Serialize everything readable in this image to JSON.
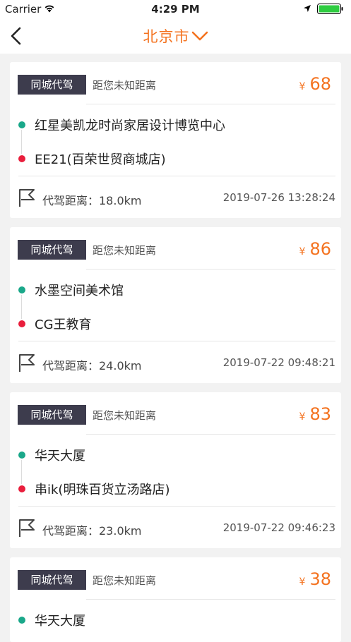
{
  "status": {
    "carrier": "Carrier",
    "time": "4:29 PM"
  },
  "nav": {
    "title": "北京市",
    "back_icon": "chevron-left-icon",
    "dropdown_icon": "chevron-down-icon"
  },
  "colors": {
    "accent": "#f47320",
    "tag_bg": "#3d3c4d",
    "start_dot": "#1aa88a",
    "end_dot": "#e91e3c"
  },
  "orders": [
    {
      "tag": "同城代驾",
      "distance_info": "距您未知距离",
      "currency": "¥",
      "price": "68",
      "start": "红星美凯龙时尚家居设计博览中心",
      "end": "EE21(百荣世贸商城店)",
      "drive_distance": "代驾距离：18.0km",
      "datetime": "2019-07-26 13:28:24"
    },
    {
      "tag": "同城代驾",
      "distance_info": "距您未知距离",
      "currency": "¥",
      "price": "86",
      "start": "水墨空间美术馆",
      "end": "CG王教育",
      "drive_distance": "代驾距离：24.0km",
      "datetime": "2019-07-22 09:48:21"
    },
    {
      "tag": "同城代驾",
      "distance_info": "距您未知距离",
      "currency": "¥",
      "price": "83",
      "start": "华天大厦",
      "end": "串ik(明珠百货立汤路店)",
      "drive_distance": "代驾距离：23.0km",
      "datetime": "2019-07-22 09:46:23"
    },
    {
      "tag": "同城代驾",
      "distance_info": "距您未知距离",
      "currency": "¥",
      "price": "38",
      "start": "华天大厦"
    }
  ]
}
